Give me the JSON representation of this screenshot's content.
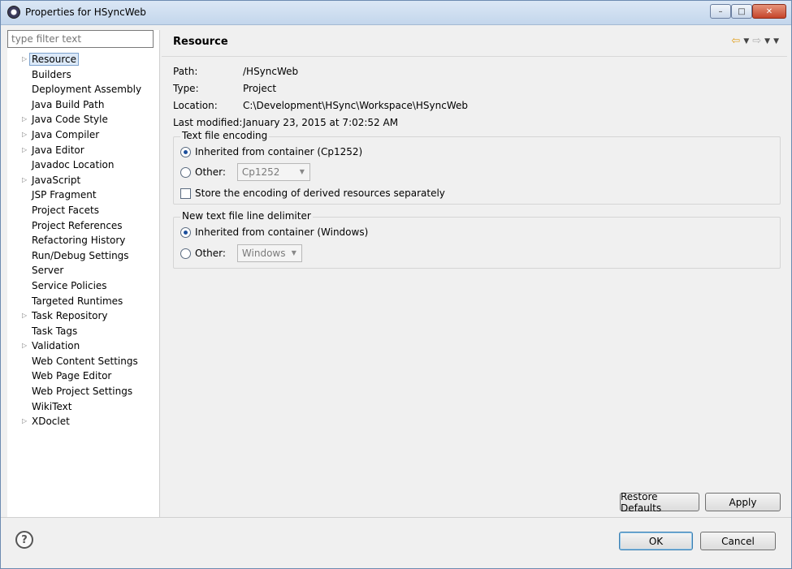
{
  "window": {
    "title": "Properties for HSyncWeb",
    "minimize_glyph": "–",
    "maximize_glyph": "□",
    "close_glyph": "✕"
  },
  "sidebar": {
    "filter_placeholder": "type filter text",
    "items": [
      {
        "label": "Resource",
        "expandable": true,
        "selected": true
      },
      {
        "label": "Builders",
        "expandable": false
      },
      {
        "label": "Deployment Assembly",
        "expandable": false
      },
      {
        "label": "Java Build Path",
        "expandable": false
      },
      {
        "label": "Java Code Style",
        "expandable": true
      },
      {
        "label": "Java Compiler",
        "expandable": true
      },
      {
        "label": "Java Editor",
        "expandable": true
      },
      {
        "label": "Javadoc Location",
        "expandable": false
      },
      {
        "label": "JavaScript",
        "expandable": true
      },
      {
        "label": "JSP Fragment",
        "expandable": false
      },
      {
        "label": "Project Facets",
        "expandable": false
      },
      {
        "label": "Project References",
        "expandable": false
      },
      {
        "label": "Refactoring History",
        "expandable": false
      },
      {
        "label": "Run/Debug Settings",
        "expandable": false
      },
      {
        "label": "Server",
        "expandable": false
      },
      {
        "label": "Service Policies",
        "expandable": false
      },
      {
        "label": "Targeted Runtimes",
        "expandable": false
      },
      {
        "label": "Task Repository",
        "expandable": true
      },
      {
        "label": "Task Tags",
        "expandable": false
      },
      {
        "label": "Validation",
        "expandable": true
      },
      {
        "label": "Web Content Settings",
        "expandable": false
      },
      {
        "label": "Web Page Editor",
        "expandable": false
      },
      {
        "label": "Web Project Settings",
        "expandable": false
      },
      {
        "label": "WikiText",
        "expandable": false
      },
      {
        "label": "XDoclet",
        "expandable": true
      }
    ]
  },
  "page": {
    "title": "Resource",
    "nav": {
      "back": "⇦",
      "forward": "⇨",
      "dropdown": "▼"
    },
    "info": {
      "path_label": "Path:",
      "path_value": "/HSyncWeb",
      "type_label": "Type:",
      "type_value": "Project",
      "location_label": "Location:",
      "location_value": "C:\\Development\\HSync\\Workspace\\HSyncWeb",
      "modified_label": "Last modified:",
      "modified_value": "January 23, 2015 at 7:02:52 AM"
    },
    "encoding": {
      "group_label": "Text file encoding",
      "inherited_label": "Inherited from container (Cp1252)",
      "inherited_selected": true,
      "other_label": "Other:",
      "other_value": "Cp1252",
      "store_label": "Store the encoding of derived resources separately",
      "store_checked": false
    },
    "delimiter": {
      "group_label": "New text file line delimiter",
      "inherited_label": "Inherited from container (Windows)",
      "inherited_selected": true,
      "other_label": "Other:",
      "other_value": "Windows"
    },
    "restore_defaults_label": "Restore Defaults",
    "apply_label": "Apply"
  },
  "footer": {
    "help_glyph": "?",
    "ok_label": "OK",
    "cancel_label": "Cancel"
  }
}
